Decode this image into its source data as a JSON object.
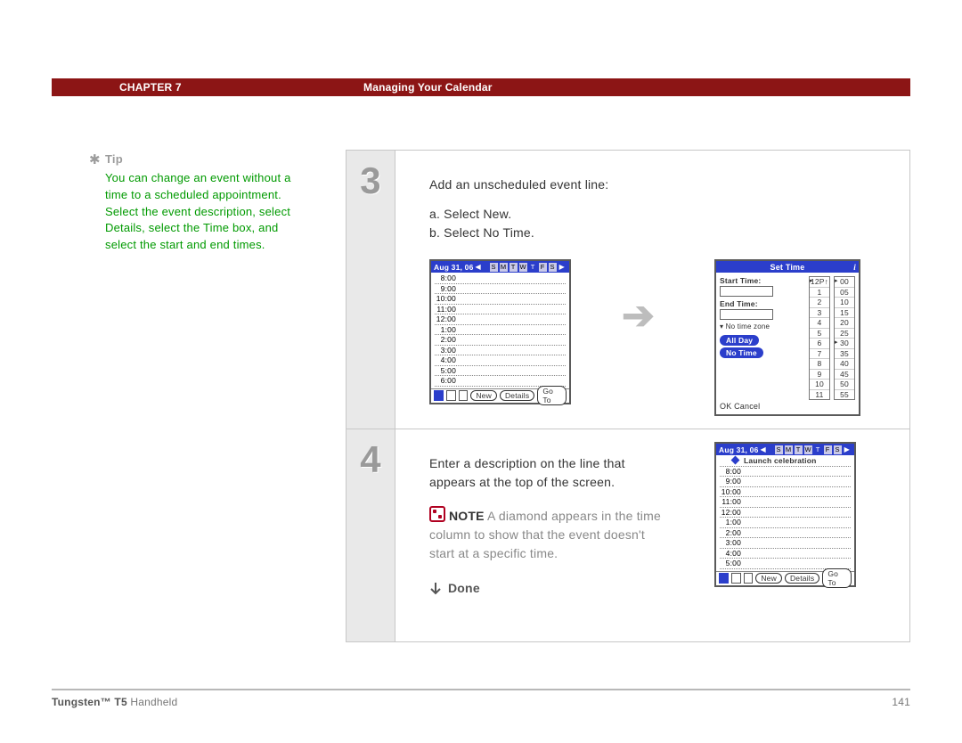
{
  "header": {
    "chapter": "CHAPTER 7",
    "title": "Managing Your Calendar"
  },
  "tip": {
    "label": "Tip",
    "body": "You can change an event without a time to a scheduled appointment. Select the event description, select Details, select the Time box, and select the start and end times."
  },
  "step3": {
    "num": "3",
    "intro": "Add an unscheduled event line:",
    "a": "a.  Select New.",
    "b": "b.  Select No Time."
  },
  "step4": {
    "num": "4",
    "desc": "Enter a description on the line that appears at the top of the screen.",
    "note_label": "NOTE",
    "note_body": " A diamond appears in the time column to show that the event doesn't start at a specific time.",
    "done": "Done"
  },
  "palm": {
    "date": "Aug 31, 06",
    "dow": [
      "S",
      "M",
      "T",
      "W",
      "T",
      "F",
      "S"
    ],
    "selected_dow_index": 4,
    "hours": [
      "8:00",
      "9:00",
      "10:00",
      "11:00",
      "12:00",
      "1:00",
      "2:00",
      "3:00",
      "4:00",
      "5:00",
      "6:00"
    ],
    "hours_short": [
      "8:00",
      "9:00",
      "10:00",
      "11:00",
      "12:00",
      "1:00",
      "2:00",
      "3:00",
      "4:00",
      "5:00"
    ],
    "event_text": "Launch celebration",
    "buttons": {
      "new": "New",
      "details": "Details",
      "goto": "Go To"
    }
  },
  "settime": {
    "title": "Set Time",
    "labels": {
      "start": "Start Time:",
      "end": "End Time:",
      "tz": "No time zone",
      "allday": "All Day",
      "notime": "No Time",
      "ok": "OK",
      "cancel": "Cancel"
    },
    "hours": [
      "12P",
      "1",
      "2",
      "3",
      "4",
      "5",
      "6",
      "7",
      "8",
      "9",
      "10",
      "11"
    ],
    "mins": [
      "00",
      "05",
      "10",
      "15",
      "20",
      "25",
      "30",
      "35",
      "40",
      "45",
      "50",
      "55"
    ]
  },
  "footer": {
    "product_bold": "Tungsten™ T5",
    "product_rest": " Handheld",
    "page": "141"
  }
}
